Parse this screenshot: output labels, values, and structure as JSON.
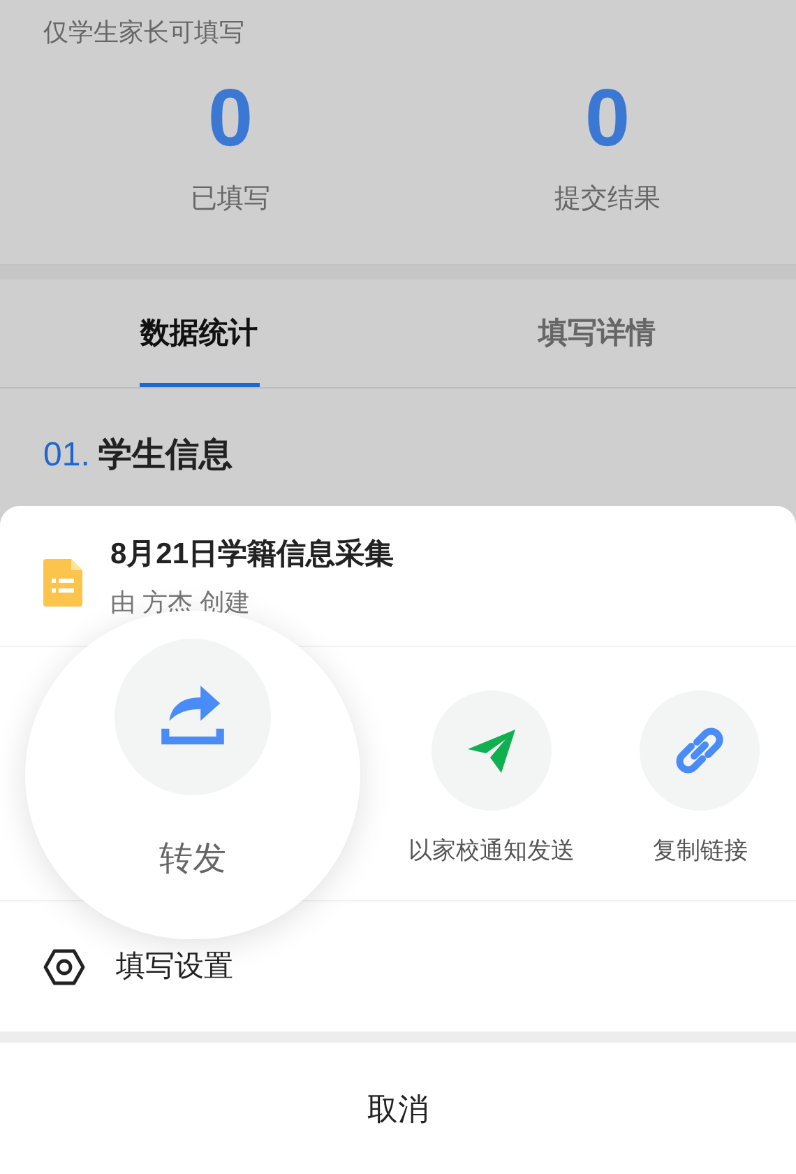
{
  "notice": "仅学生家长可填写",
  "stats": [
    {
      "value": "0",
      "label": "已填写"
    },
    {
      "value": "0",
      "label": "提交结果"
    }
  ],
  "tabs": [
    {
      "label": "数据统计",
      "selected": true
    },
    {
      "label": "填写详情",
      "selected": false
    }
  ],
  "section": {
    "number": "01.",
    "title": "学生信息"
  },
  "sheet": {
    "title": "8月21日学籍信息采集",
    "subtitle": "由 方杰 创建",
    "actions": [
      {
        "kind": "forward",
        "label": "转发",
        "highlighted": true
      },
      {
        "kind": "notify",
        "label": "以家校通知发送",
        "highlighted": false
      },
      {
        "kind": "link",
        "label": "复制链接",
        "highlighted": false
      }
    ],
    "settings": "填写设置",
    "cancel": "取消"
  }
}
